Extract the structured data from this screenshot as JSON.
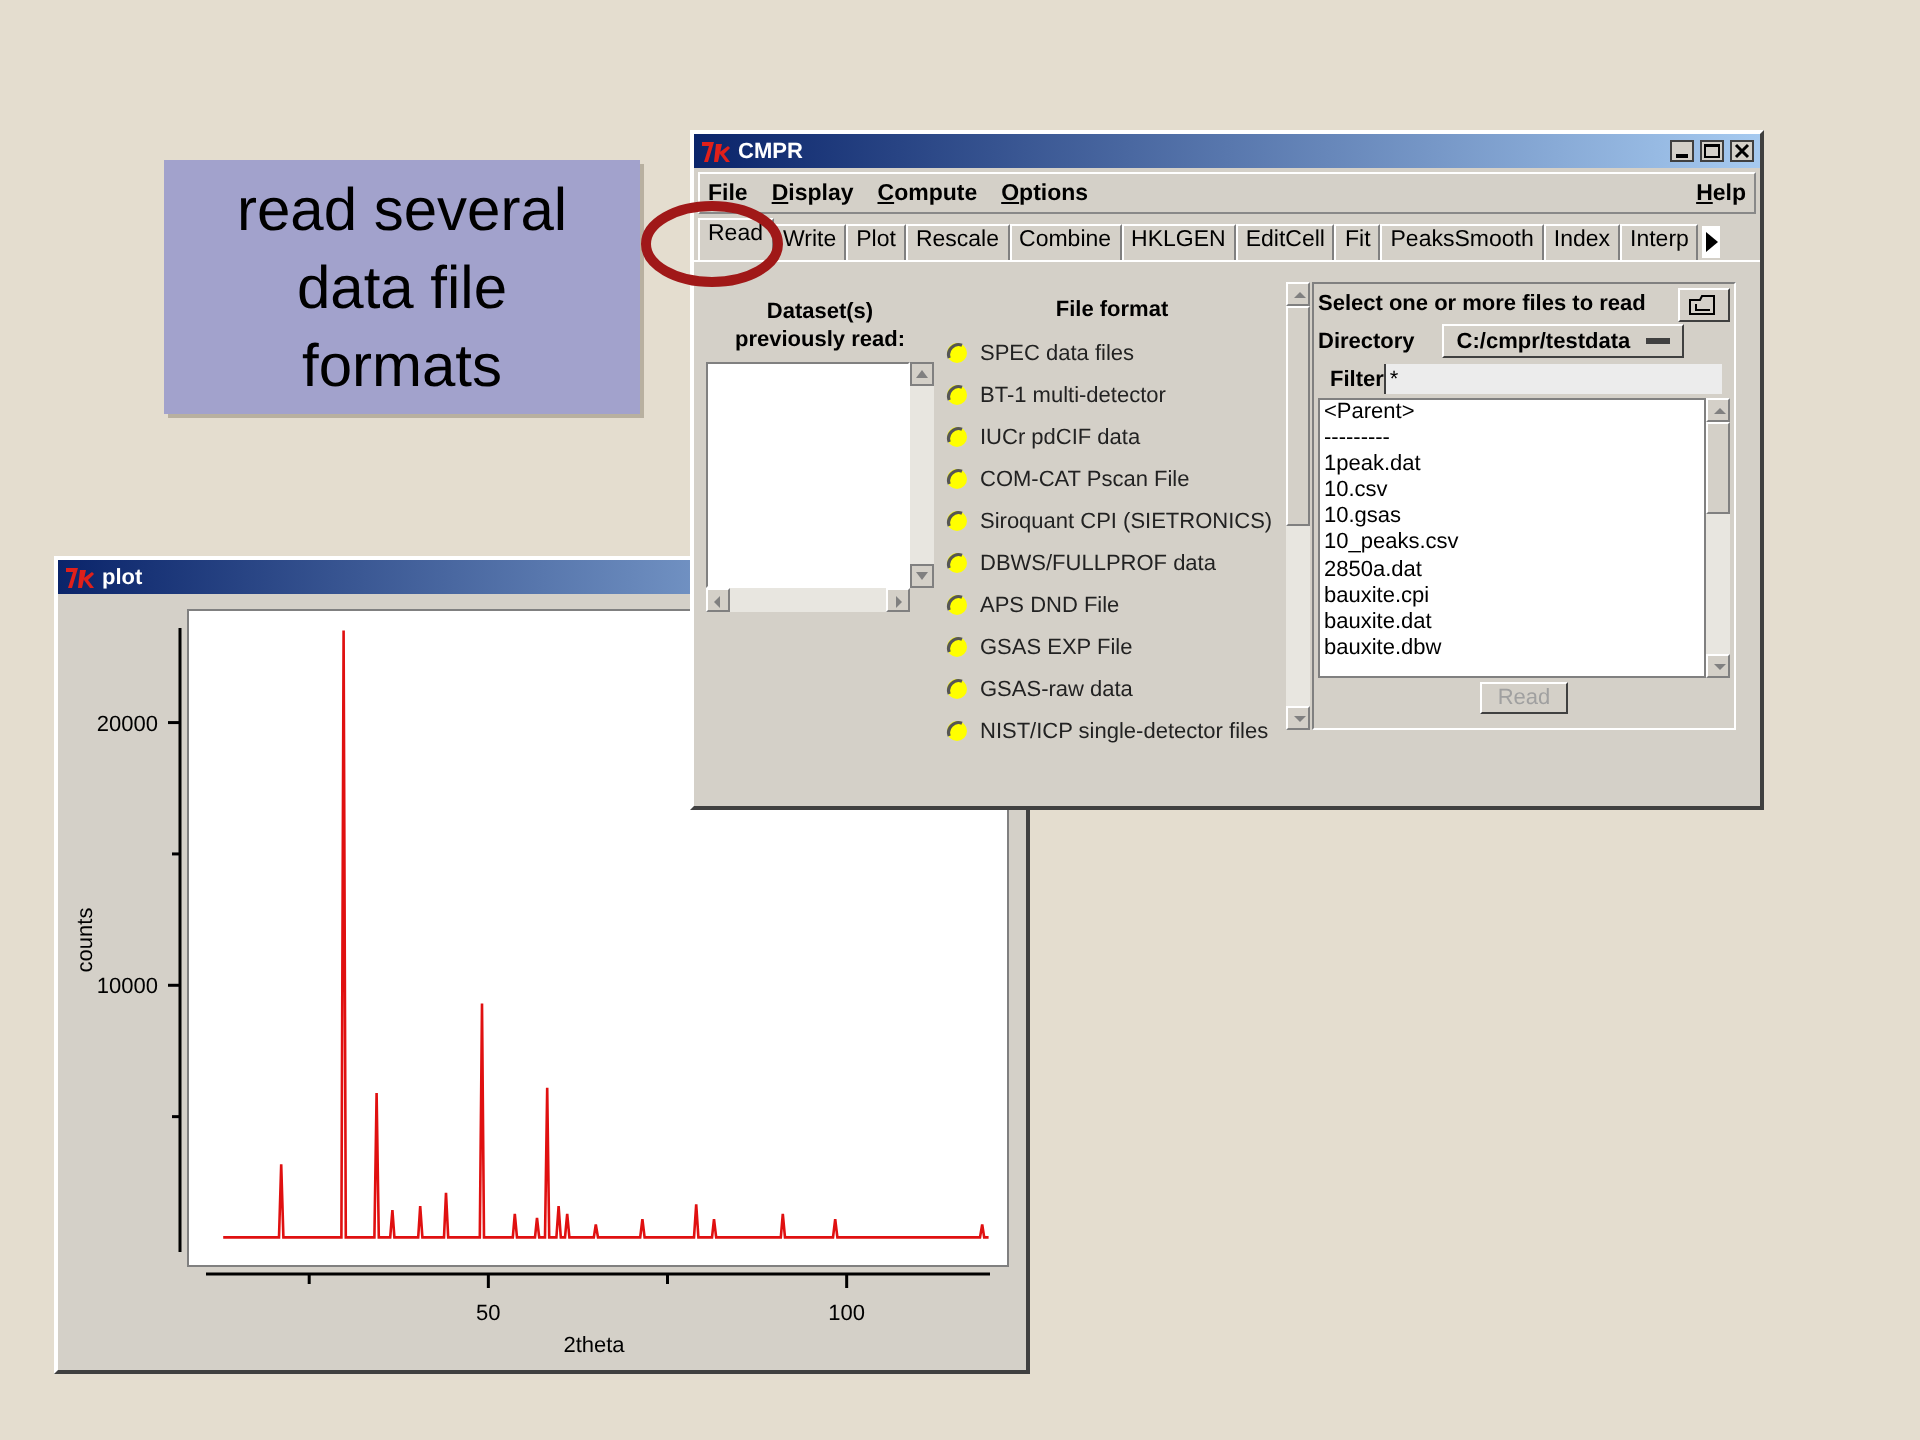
{
  "callout": "read several data file formats",
  "cmpr_window": {
    "title": "CMPR",
    "menu": [
      {
        "label": "File"
      },
      {
        "label": "Display"
      },
      {
        "label": "Compute"
      },
      {
        "label": "Options"
      }
    ],
    "help": "Help",
    "tabs": [
      {
        "label": "Read",
        "selected": true
      },
      {
        "label": "Write",
        "selected": false
      },
      {
        "label": "Plot",
        "selected": false
      },
      {
        "label": "Rescale",
        "selected": false
      },
      {
        "label": "Combine",
        "selected": false
      },
      {
        "label": "HKLGEN",
        "selected": false
      },
      {
        "label": "EditCell",
        "selected": false
      },
      {
        "label": "Fit",
        "selected": false
      },
      {
        "label": "PeaksSmooth",
        "selected": false
      },
      {
        "label": "Index",
        "selected": false
      },
      {
        "label": "Interp",
        "selected": false
      }
    ],
    "dataset_heading": "Dataset(s) previously read:",
    "file_format_heading": "File format",
    "formats": [
      {
        "label": "SPEC data files",
        "selected": false
      },
      {
        "label": "BT-1 multi-detector",
        "selected": false
      },
      {
        "label": "IUCr pdCIF data",
        "selected": false
      },
      {
        "label": "COM-CAT Pscan File",
        "selected": false
      },
      {
        "label": "Siroquant CPI (SIETRONICS)",
        "selected": false
      },
      {
        "label": "DBWS/FULLPROF data",
        "selected": false
      },
      {
        "label": "APS DND File",
        "selected": false
      },
      {
        "label": "GSAS EXP File",
        "selected": false
      },
      {
        "label": "GSAS-raw data",
        "selected": false
      },
      {
        "label": "NIST/ICP single-detector files",
        "selected": false
      }
    ],
    "file_panel": {
      "heading": "Select one or more files to read",
      "directory_label": "Directory",
      "directory": "C:/cmpr/testdata",
      "filter_label": "Filter",
      "filter": "*",
      "files": [
        "<Parent>",
        "---------",
        "1peak.dat",
        "10.csv",
        "10.gsas",
        "10_peaks.csv",
        "2850a.dat",
        "bauxite.cpi",
        "bauxite.dat",
        "bauxite.dbw"
      ],
      "read_button": {
        "label": "Read",
        "disabled": true
      }
    }
  },
  "plot_window": {
    "title": "plot",
    "chart_data": {
      "type": "line",
      "xlabel": "2theta",
      "ylabel": "counts",
      "xlim": [
        10.6,
        120
      ],
      "ylim": [
        0,
        23600
      ],
      "xticks": [
        50,
        100
      ],
      "yticks": [
        10000,
        20000
      ],
      "x": [
        13,
        20.8,
        21.1,
        21.4,
        29.5,
        29.8,
        30.1,
        34.1,
        34.4,
        34.7,
        36.3,
        36.6,
        36.9,
        40.2,
        40.5,
        40.8,
        43.8,
        44.1,
        44.4,
        48.8,
        49.1,
        49.4,
        53.4,
        53.7,
        54.0,
        56.5,
        56.8,
        57.1,
        57.9,
        58.2,
        58.5,
        59.5,
        59.8,
        60.1,
        60.7,
        61.0,
        61.3,
        64.7,
        65.0,
        65.3,
        71.2,
        71.5,
        71.8,
        78.7,
        79.0,
        79.3,
        81.2,
        81.5,
        81.8,
        90.8,
        91.1,
        91.4,
        98.1,
        98.4,
        98.7,
        118.6,
        118.9,
        119.2,
        119.8
      ],
      "values": [
        400,
        400,
        3180,
        400,
        400,
        23500,
        400,
        400,
        5900,
        400,
        400,
        1440,
        400,
        400,
        1600,
        400,
        400,
        2100,
        400,
        400,
        9300,
        400,
        400,
        1300,
        400,
        400,
        1140,
        400,
        400,
        6100,
        400,
        400,
        1600,
        400,
        400,
        1300,
        400,
        400,
        900,
        400,
        400,
        1100,
        400,
        400,
        1660,
        400,
        400,
        1100,
        400,
        400,
        1300,
        400,
        400,
        1100,
        400,
        400,
        900,
        400,
        400
      ]
    }
  }
}
